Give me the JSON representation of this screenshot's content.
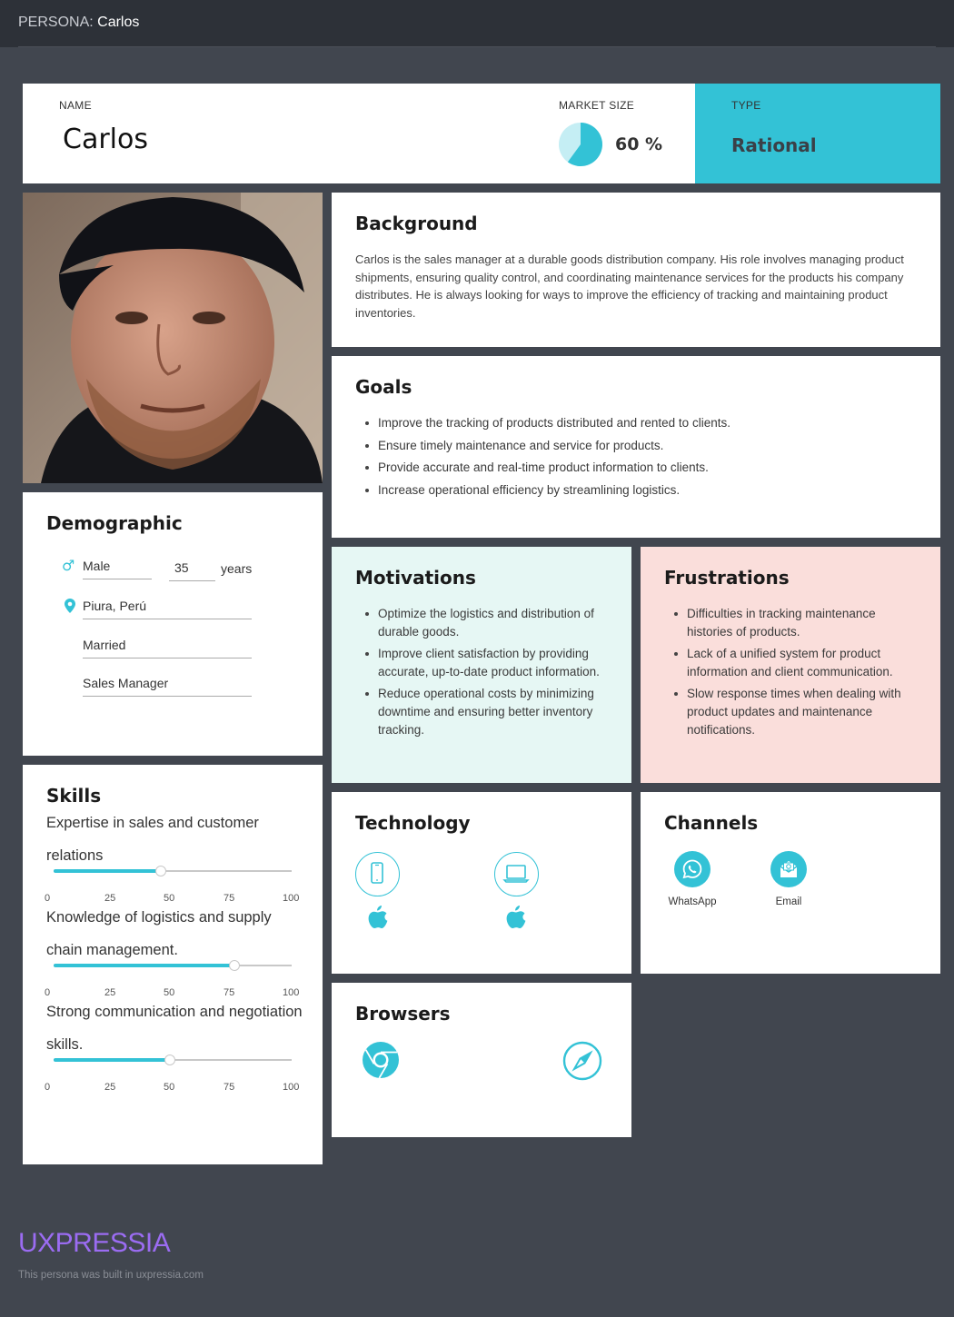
{
  "topbar": {
    "prefix": "PERSONA:",
    "name": "Carlos"
  },
  "header": {
    "name_label": "NAME",
    "name": "Carlos",
    "market_size_label": "MARKET SIZE",
    "market_size_value": "60 %",
    "market_size_fraction": 0.6,
    "type_label": "TYPE",
    "type_value": "Rational"
  },
  "background": {
    "title": "Background",
    "text": "Carlos is the sales manager at a durable goods distribution company. His role involves managing product shipments, ensuring quality control, and coordinating maintenance services for the products his company distributes. He is always looking for ways to improve the efficiency of tracking and maintaining product inventories."
  },
  "goals": {
    "title": "Goals",
    "items": [
      "Improve the tracking of products distributed and rented to clients.",
      "Ensure timely maintenance and service for products.",
      "Provide accurate and real-time product information to clients.",
      "Increase operational efficiency by streamlining logistics."
    ]
  },
  "demographic": {
    "title": "Demographic",
    "gender": "Male",
    "age": "35",
    "age_unit": "years",
    "location": "Piura, Perú",
    "marital_status": "Married",
    "occupation": "Sales Manager"
  },
  "motivations": {
    "title": "Motivations",
    "items": [
      "Optimize the logistics and distribution of durable goods.",
      "Improve client satisfaction by providing accurate, up-to-date product information.",
      "Reduce operational costs by minimizing downtime and ensuring better inventory tracking."
    ]
  },
  "frustrations": {
    "title": "Frustrations",
    "items": [
      "Difficulties in tracking maintenance histories of products.",
      "Lack of a unified system for product information and client communication.",
      "Slow response times when dealing with product updates and maintenance notifications."
    ]
  },
  "skills": {
    "title": "Skills",
    "scale": [
      "0",
      "25",
      "50",
      "75",
      "100"
    ],
    "items": [
      {
        "label": "Expertise in sales and customer relations",
        "value": 45
      },
      {
        "label": "Knowledge of logistics and supply chain management.",
        "value": 76
      },
      {
        "label": "Strong communication and negotiation skills.",
        "value": 49
      }
    ]
  },
  "technology": {
    "title": "Technology",
    "devices": [
      {
        "device_icon": "smartphone-icon",
        "os_icon": "apple-icon"
      },
      {
        "device_icon": "laptop-icon",
        "os_icon": "apple-icon"
      }
    ]
  },
  "channels": {
    "title": "Channels",
    "items": [
      {
        "icon": "whatsapp-icon",
        "label": "WhatsApp"
      },
      {
        "icon": "email-icon",
        "label": "Email"
      }
    ]
  },
  "browsers": {
    "title": "Browsers",
    "items": [
      {
        "icon": "chrome-icon"
      },
      {
        "icon": "safari-icon"
      }
    ]
  },
  "colors": {
    "accent": "#33c2d6",
    "background": "#41464f",
    "topbar": "#2d3138",
    "motivations_bg": "#e6f7f4",
    "frustrations_bg": "#fadedb",
    "logo": "#9b6cf2"
  },
  "footer": {
    "logo": "UXPRESSIA",
    "note": "This persona was built in uxpressia.com"
  }
}
